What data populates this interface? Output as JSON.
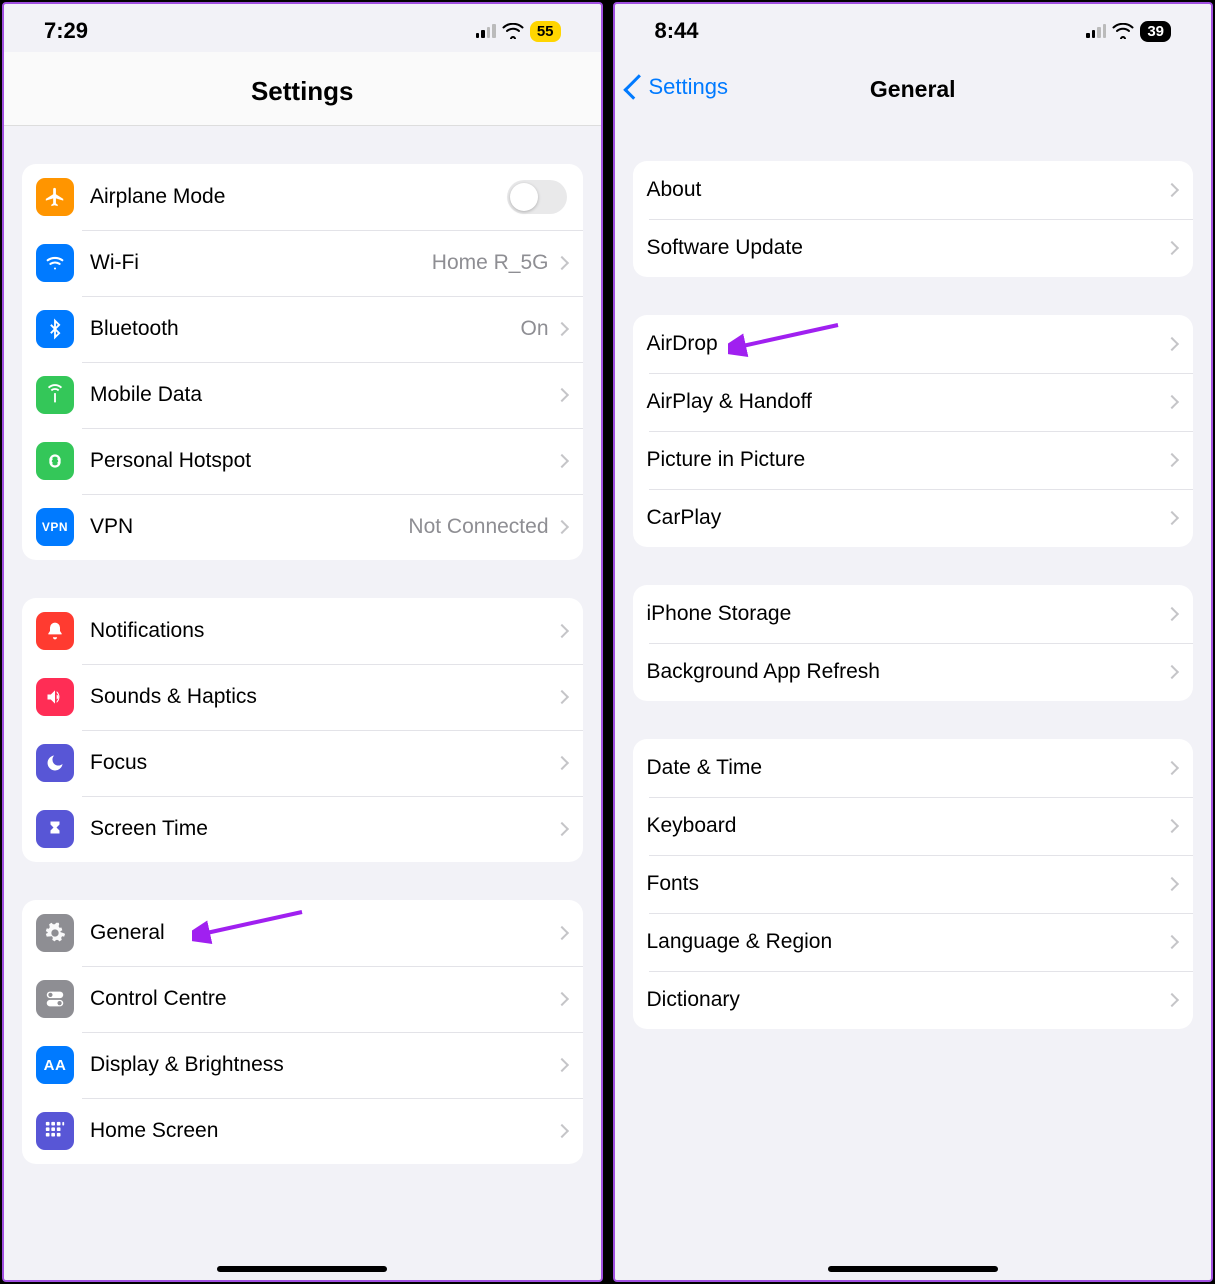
{
  "left": {
    "status": {
      "time": "7:29",
      "battery": "55"
    },
    "title": "Settings",
    "groups": [
      {
        "rows": [
          {
            "label": "Airplane Mode",
            "kind": "toggle",
            "iconColor": "ic-orange",
            "iconName": "airplane-icon"
          },
          {
            "label": "Wi-Fi",
            "value": "Home R_5G",
            "iconColor": "ic-blue",
            "iconName": "wifi-icon"
          },
          {
            "label": "Bluetooth",
            "value": "On",
            "iconColor": "ic-blue",
            "iconName": "bluetooth-icon"
          },
          {
            "label": "Mobile Data",
            "iconColor": "ic-green",
            "iconName": "antenna-icon"
          },
          {
            "label": "Personal Hotspot",
            "iconColor": "ic-green",
            "iconName": "hotspot-icon"
          },
          {
            "label": "VPN",
            "value": "Not Connected",
            "iconColor": "ic-bluevpn",
            "iconName": "vpn-icon",
            "iconText": "VPN"
          }
        ]
      },
      {
        "rows": [
          {
            "label": "Notifications",
            "iconColor": "ic-red",
            "iconName": "bell-icon"
          },
          {
            "label": "Sounds & Haptics",
            "iconColor": "ic-redpink",
            "iconName": "speaker-icon"
          },
          {
            "label": "Focus",
            "iconColor": "ic-purple",
            "iconName": "moon-icon"
          },
          {
            "label": "Screen Time",
            "iconColor": "ic-purple",
            "iconName": "hourglass-icon"
          }
        ]
      },
      {
        "rows": [
          {
            "label": "General",
            "iconColor": "ic-gray",
            "iconName": "gear-icon",
            "annot": true
          },
          {
            "label": "Control Centre",
            "iconColor": "ic-gray",
            "iconName": "switches-icon"
          },
          {
            "label": "Display & Brightness",
            "iconColor": "ic-darkblue",
            "iconName": "text-size-icon",
            "iconText": "AA"
          },
          {
            "label": "Home Screen",
            "iconColor": "ic-indigo",
            "iconName": "grid-icon"
          }
        ]
      }
    ]
  },
  "right": {
    "status": {
      "time": "8:44",
      "battery": "39"
    },
    "back": "Settings",
    "title": "General",
    "groups": [
      {
        "rows": [
          {
            "label": "About"
          },
          {
            "label": "Software Update"
          }
        ]
      },
      {
        "rows": [
          {
            "label": "AirDrop",
            "annot": true
          },
          {
            "label": "AirPlay & Handoff"
          },
          {
            "label": "Picture in Picture"
          },
          {
            "label": "CarPlay"
          }
        ]
      },
      {
        "rows": [
          {
            "label": "iPhone Storage"
          },
          {
            "label": "Background App Refresh"
          }
        ]
      },
      {
        "rows": [
          {
            "label": "Date & Time"
          },
          {
            "label": "Keyboard"
          },
          {
            "label": "Fonts"
          },
          {
            "label": "Language & Region"
          },
          {
            "label": "Dictionary"
          }
        ]
      }
    ]
  }
}
